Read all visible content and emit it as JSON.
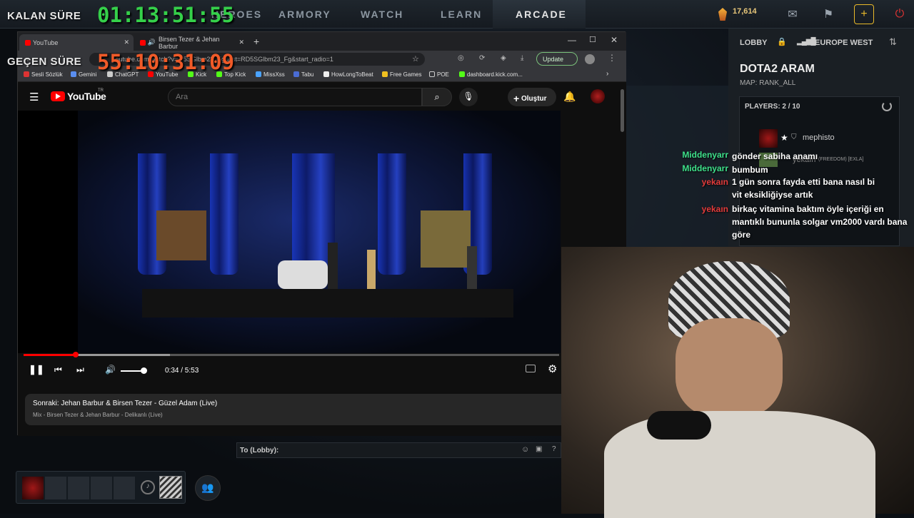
{
  "overlay": {
    "remaining_label": "KALAN SÜRE",
    "remaining_time": "01:13:51:55",
    "elapsed_label": "GEÇEN SÜRE",
    "elapsed_time": "55:10:31:09"
  },
  "dota_nav": {
    "items": [
      "HEROES",
      "ARMORY",
      "WATCH",
      "LEARN",
      "ARCADE"
    ],
    "active": "ARCADE",
    "currency": "17,614"
  },
  "browser": {
    "tabs": [
      {
        "title": "YouTube"
      },
      {
        "title": "Birsen Tezer & Jehan Barbur"
      }
    ],
    "url": "youtube.com/watch?v=...5SGlbm23_Fg&list=RD5SGlbm23_Fg&start_radio=1",
    "update_label": "Update",
    "bookmarks": [
      "Sesli Sözlük",
      "Gemini",
      "ChatGPT",
      "YouTube",
      "Kick",
      "Top Kick",
      "MissXss",
      "Tabu",
      "HowLongToBeat",
      "Free Games",
      "POE",
      "dashboard.kick.com..."
    ]
  },
  "youtube": {
    "logo": "YouTube",
    "region": "TR",
    "search_placeholder": "Ara",
    "create_label": "Oluştur",
    "time": "0:34 / 5:53",
    "progress": 0.097,
    "volume": 1.0,
    "next_title": "Sonraki: Jehan Barbur & Birsen Tezer - Güzel Adam (Live)",
    "next_subtitle": "Mix - Birsen Tezer & Jehan Barbur - Delikanlı (Live)"
  },
  "lobby": {
    "tab": "LOBBY",
    "region": "EUROPE WEST",
    "title": "DOTA2 ARAM",
    "map": "MAP: RANK_ALL",
    "players_header": "PLAYERS: 2 / 10",
    "players": [
      {
        "name": "mephisto",
        "tag": ""
      },
      {
        "name": "yekaın",
        "tag": "(FREEDOM) [EXLA]"
      }
    ]
  },
  "chat": [
    {
      "user": "Middenyarr",
      "color": "#3ee08a",
      "text": "gönder sabiha anamı"
    },
    {
      "user": "Middenyarr",
      "color": "#3ee08a",
      "text": "bumbum"
    },
    {
      "user": "yekaın",
      "color": "#e23b3b",
      "text": "1 gün sonra fayda etti bana nasıl bi vit eksikliğiyse artık"
    },
    {
      "user": "yekaın",
      "color": "#e23b3b",
      "text": "birkaç vitamina baktım öyle içeriği en mantıklı bununla solgar vm2000 vardı bana göre"
    }
  ],
  "lobby_chat": {
    "label": "To (Lobby):",
    "help": "?"
  }
}
